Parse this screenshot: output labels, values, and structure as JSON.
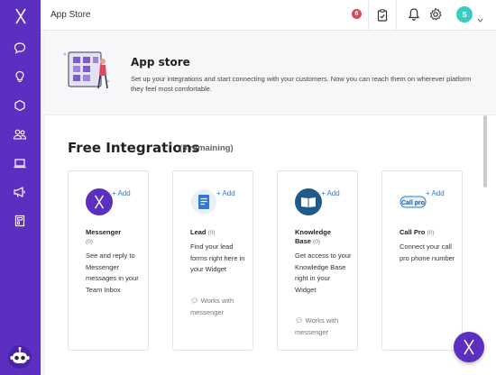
{
  "sidebar": {
    "items": [
      {
        "icon": "chat-bubble-icon"
      },
      {
        "icon": "lightbulb-icon"
      },
      {
        "icon": "hexagon-icon"
      },
      {
        "icon": "users-icon"
      },
      {
        "icon": "laptop-icon"
      },
      {
        "icon": "megaphone-icon"
      },
      {
        "icon": "calculator-icon"
      }
    ]
  },
  "topbar": {
    "title": "App Store",
    "notification_count": "6",
    "avatar_initial": "S"
  },
  "header": {
    "title": "App store",
    "description": "Set up your integrations and start connecting with your customers. Now you can reach them on wherever platform they feel most comfortable."
  },
  "section": {
    "title": "Free Integrations",
    "remaining": "(5 remaining)"
  },
  "cards": [
    {
      "name": "Messenger",
      "count": "(0)",
      "add": "+ Add",
      "desc": "See and reply to Messenger messages in your Team Inbox",
      "works": "",
      "icon": "messenger-icon",
      "icon_color": "#5b2fc0"
    },
    {
      "name": "Lead",
      "count": "(0)",
      "add": "+ Add",
      "desc": "Find your lead forms right here in your Widget",
      "works": "Works with messenger",
      "icon": "document-icon",
      "icon_color": "#ffffff"
    },
    {
      "name": "Knowledge Base",
      "count": "(0)",
      "add": "+ Add",
      "desc": "Get access to your Knowledge Base right in your Widget",
      "works": "Works with messenger",
      "icon": "book-icon",
      "icon_color": "#1f5b8a"
    },
    {
      "name": "Call Pro",
      "count": "(0)",
      "add": "+ Add",
      "desc": "Connect your call pro phone number",
      "works": "",
      "icon": "callpro-logo-icon",
      "icon_color": "#ffffff"
    }
  ],
  "colors": {
    "brand": "#5b2fc0",
    "link": "#2b7bd6",
    "badge": "#e0485a",
    "avatar": "#3ccbc1"
  }
}
